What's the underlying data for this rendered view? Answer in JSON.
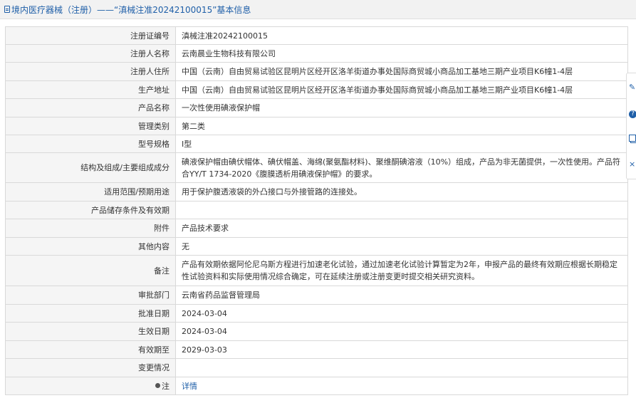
{
  "header": {
    "title": "境内医疗器械（注册）——“滇械注准20242100015”基本信息",
    "color": "#1f5fa8"
  },
  "rows": [
    {
      "label": "注册证编号",
      "value": "滇械注准20242100015"
    },
    {
      "label": "注册人名称",
      "value": "云南晨业生物科技有限公司"
    },
    {
      "label": "注册人住所",
      "value": "中国（云南）自由贸易试验区昆明片区经开区洛羊街道办事处国际商贸城小商品加工基地三期产业项目K6幢1-4层"
    },
    {
      "label": "生产地址",
      "value": "中国（云南）自由贸易试验区昆明片区经开区洛羊街道办事处国际商贸城小商品加工基地三期产业项目K6幢1-4层"
    },
    {
      "label": "产品名称",
      "value": "一次性使用碘液保护帽"
    },
    {
      "label": "管理类别",
      "value": "第二类"
    },
    {
      "label": "型号规格",
      "value": "Ⅰ型"
    },
    {
      "label": "结构及组成/主要组成成分",
      "value": "碘液保护帽由碘伏帽体、碘伏帽盖、海绵(聚氨酯材料)、聚维酮碘溶液（10%）组成，产品为非无菌提供，一次性使用。产品符合YY/T 1734-2020《腹膜透析用碘液保护帽》的要求。"
    },
    {
      "label": "适用范围/预期用途",
      "value": "用于保护腹透液袋的外凸接口与外接管路的连接处。"
    },
    {
      "label": "产品储存条件及有效期",
      "value": ""
    },
    {
      "label": "附件",
      "value": "产品技术要求"
    },
    {
      "label": "其他内容",
      "value": "无"
    },
    {
      "label": "备注",
      "value": "产品有效期依据阿伦尼乌斯方程进行加速老化试验，通过加速老化试验计算暂定为2年，申报产品的最终有效期应根据长期稳定性试验资料和实际使用情况综合确定，可在延续注册或注册变更时提交相关研究资料。"
    },
    {
      "label": "审批部门",
      "value": "云南省药品监督管理局"
    },
    {
      "label": "批准日期",
      "value": "2024-03-04"
    },
    {
      "label": "生效日期",
      "value": "2024-03-04"
    },
    {
      "label": "有效期至",
      "value": "2029-03-03"
    },
    {
      "label": "变更情况",
      "value": ""
    }
  ],
  "note_row": {
    "label": "注",
    "link": "详情"
  }
}
